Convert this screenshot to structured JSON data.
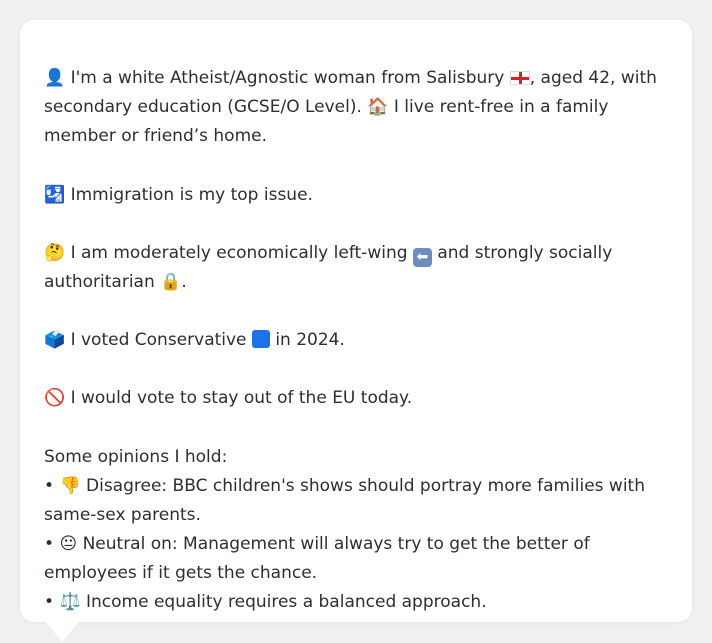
{
  "profile": {
    "intro": {
      "person_emoji": "👤",
      "text_1": "I'm a white Atheist/Agnostic woman from Salisbury",
      "flag_icon": "england-flag-icon",
      "text_2": ", aged 42, with secondary education (GCSE/O Level).",
      "house_emoji": "🏠",
      "text_3": "I live rent-free in a family member or friend’s home."
    },
    "top_issue": {
      "emoji": "🛂",
      "text": "Immigration is my top issue."
    },
    "ideology": {
      "emoji": "🤔",
      "text_1": "I am moderately economically left-wing",
      "arrow_emoji": "⬅",
      "text_2": "and strongly socially authoritarian",
      "lock_emoji": "🔒",
      "text_3": "."
    },
    "vote": {
      "emoji": "🗳️",
      "text_1": "I voted Conservative",
      "party_color": "#1a73e8",
      "text_2": "in 2024."
    },
    "eu": {
      "emoji": "🚫",
      "text": "I would vote to stay out of the EU today."
    },
    "opinions": {
      "heading": "Some opinions I hold:",
      "items": [
        {
          "bullet": "•",
          "emoji": "👎",
          "text": "Disagree: BBC children's shows should portray more families with same-sex parents."
        },
        {
          "bullet": "•",
          "emoji": "😐",
          "text": "Neutral on: Management will always try to get the better of employees if it gets the chance."
        },
        {
          "bullet": "•",
          "emoji": "⚖️",
          "text": "Income equality requires a balanced approach."
        }
      ]
    }
  },
  "colors": {
    "page_background": "#eef0f2",
    "card_background": "#ffffff",
    "text": "#2b2f33"
  }
}
